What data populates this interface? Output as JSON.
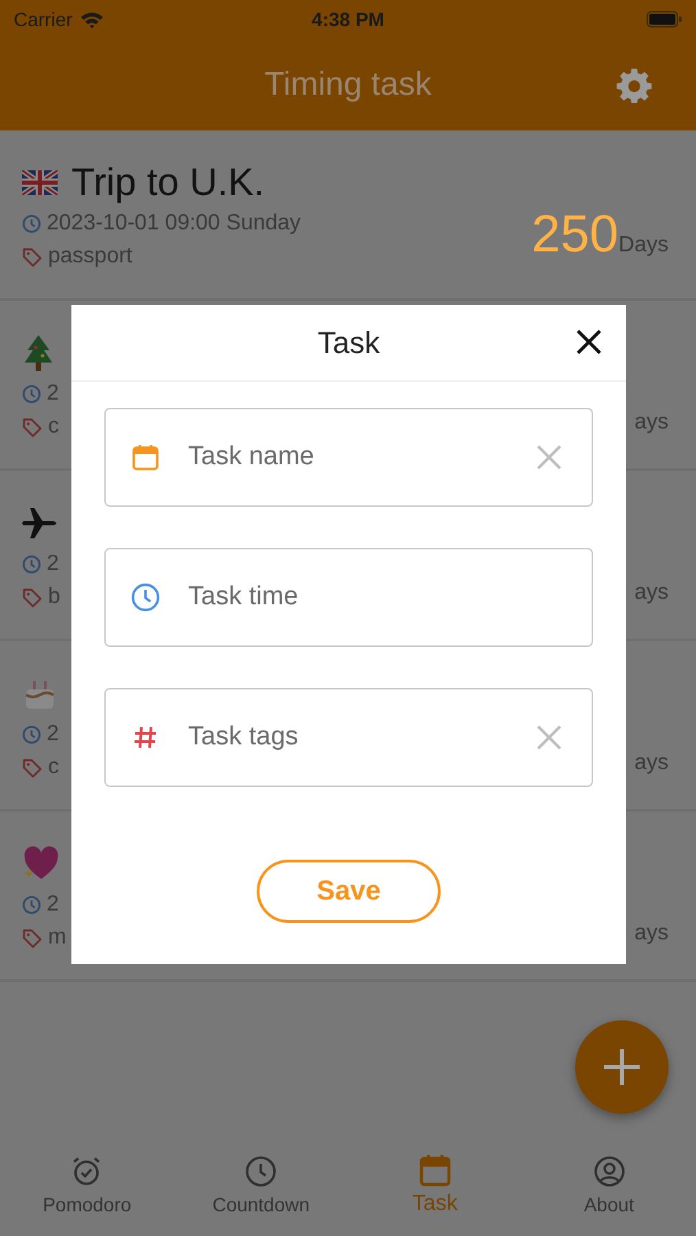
{
  "status_bar": {
    "carrier": "Carrier",
    "time": "4:38 PM"
  },
  "header": {
    "title": "Timing task"
  },
  "tasks": [
    {
      "kind": "flag",
      "title": "Trip to U.K.",
      "time": "2023-10-01 09:00 Sunday",
      "tag": "passport",
      "days": "250",
      "unit": "Days"
    },
    {
      "kind": "tree",
      "time": "2",
      "tag": "c",
      "unit": "ays"
    },
    {
      "kind": "plane",
      "time": "2",
      "tag": "b",
      "unit": "ays"
    },
    {
      "kind": "cake",
      "time": "2",
      "tag": "c",
      "unit": "ays"
    },
    {
      "kind": "heart",
      "time": "2",
      "tag": "m",
      "unit": "ays"
    }
  ],
  "dialog": {
    "title": "Task",
    "fields": [
      {
        "kind": "name",
        "placeholder": "Task name",
        "clearable": true
      },
      {
        "kind": "time",
        "placeholder": "Task time",
        "clearable": false
      },
      {
        "kind": "tags",
        "placeholder": "Task tags",
        "clearable": true
      }
    ],
    "save": "Save"
  },
  "tabs": [
    {
      "kind": "alarm",
      "label": "Pomodoro",
      "selected": false
    },
    {
      "kind": "clock",
      "label": "Countdown",
      "selected": false
    },
    {
      "kind": "calendar",
      "label": "Task",
      "selected": true
    },
    {
      "kind": "person",
      "label": "About",
      "selected": false
    }
  ]
}
